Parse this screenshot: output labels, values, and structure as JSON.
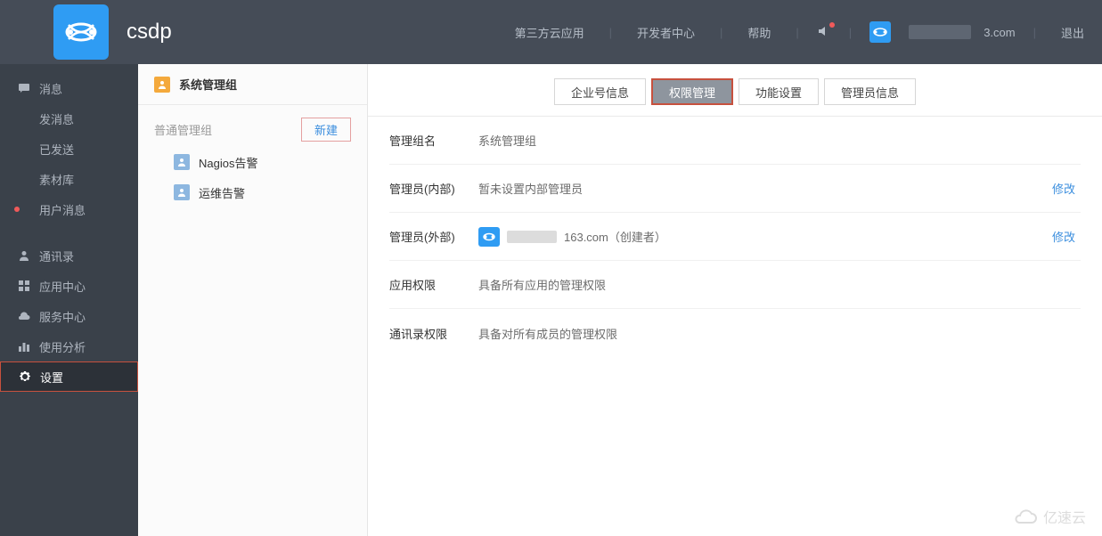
{
  "header": {
    "app_title": "csdp",
    "links": {
      "third_party": "第三方云应用",
      "dev_center": "开发者中心",
      "help": "帮助"
    },
    "user_email_suffix": "3.com",
    "logout": "退出"
  },
  "sidebar": {
    "messages": "消息",
    "send_message": "发消息",
    "sent": "已发送",
    "media": "素材库",
    "user_messages": "用户消息",
    "contacts": "通讯录",
    "app_center": "应用中心",
    "service_center": "服务中心",
    "analytics": "使用分析",
    "settings": "设置"
  },
  "midcol": {
    "system_group": "系统管理组",
    "normal_group_label": "普通管理组",
    "new_btn": "新建",
    "items": [
      "Nagios告警",
      "运维告警"
    ]
  },
  "tabs": {
    "enterprise_info": "企业号信息",
    "permission_mgmt": "权限管理",
    "feature_settings": "功能设置",
    "admin_info": "管理员信息"
  },
  "detail": {
    "group_name_label": "管理组名",
    "group_name_value": "系统管理组",
    "admin_internal_label": "管理员(内部)",
    "admin_internal_value": "暂未设置内部管理员",
    "admin_external_label": "管理员(外部)",
    "admin_external_suffix": "163.com（创建者）",
    "app_perm_label": "应用权限",
    "app_perm_value": "具备所有应用的管理权限",
    "contact_perm_label": "通讯录权限",
    "contact_perm_value": "具备对所有成员的管理权限",
    "modify": "修改"
  },
  "watermark": "亿速云"
}
